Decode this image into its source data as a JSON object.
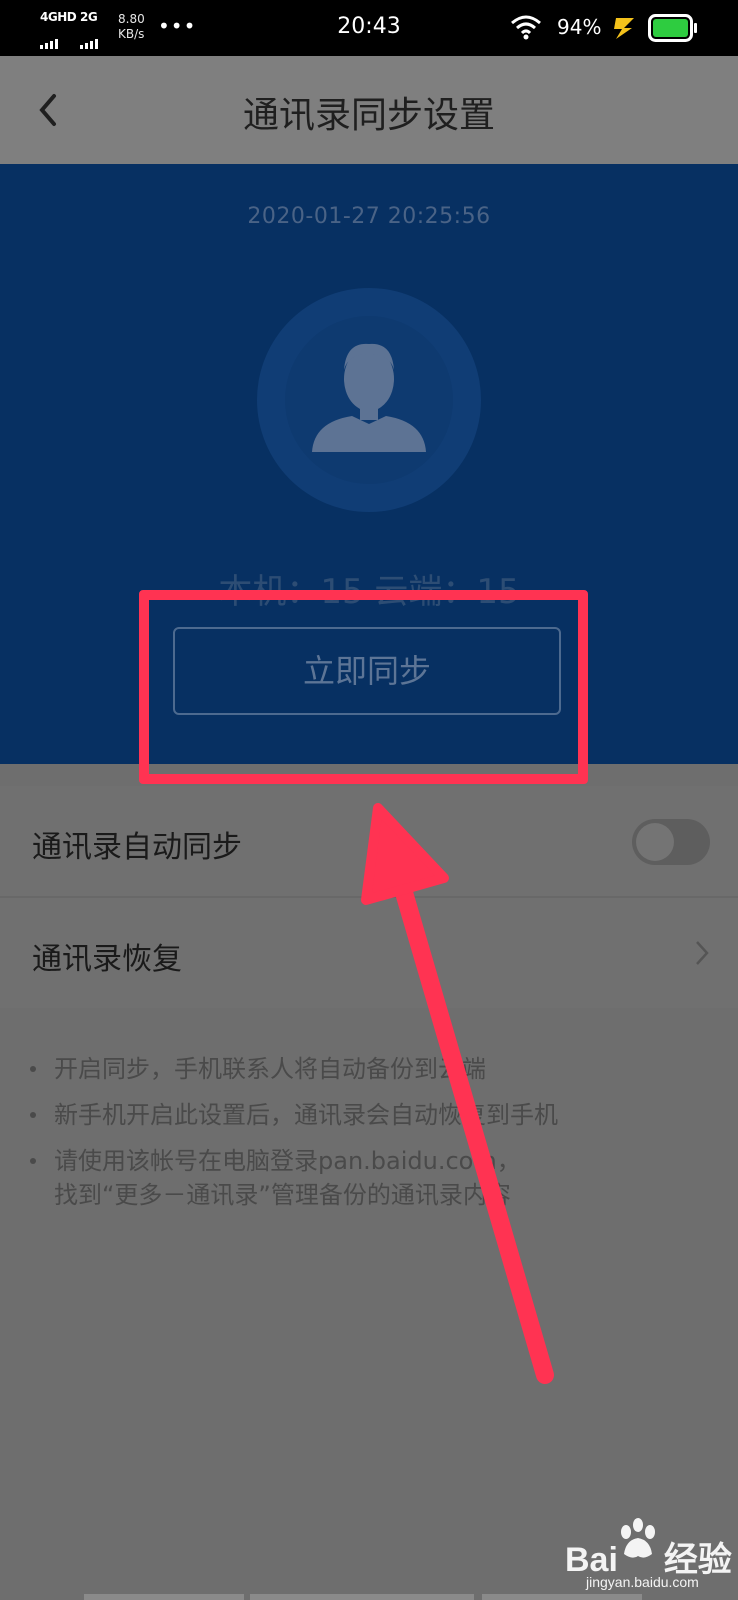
{
  "status_bar": {
    "network1": "4GHD",
    "network2": "2G",
    "speed_value": "8.80",
    "speed_unit": "KB/s",
    "more": "•••",
    "time": "20:43",
    "battery_percent": "94%"
  },
  "header": {
    "title": "通讯录同步设置",
    "back_icon": "chevron-left-icon"
  },
  "sync_panel": {
    "timestamp": "2020-01-27  20:25:56",
    "counts": "本机：15  云端：15",
    "sync_button": "立即同步",
    "background_color": "#073062"
  },
  "settings": {
    "auto_sync_label": "通讯录自动同步",
    "auto_sync_enabled": false,
    "restore_label": "通讯录恢复"
  },
  "notes": [
    "开启同步，手机联系人将自动备份到云端",
    "新手机开启此设置后，通讯录会自动恢复到手机",
    "请使用该帐号在电脑登录pan.baidu.com，\n找到“更多－通讯录”管理备份的通讯录内容"
  ],
  "annotation": {
    "highlight_color": "#ff3352"
  },
  "watermark": {
    "brand": "Bai",
    "brand_suffix": "经验",
    "domain": "jingyan.baidu.com"
  }
}
